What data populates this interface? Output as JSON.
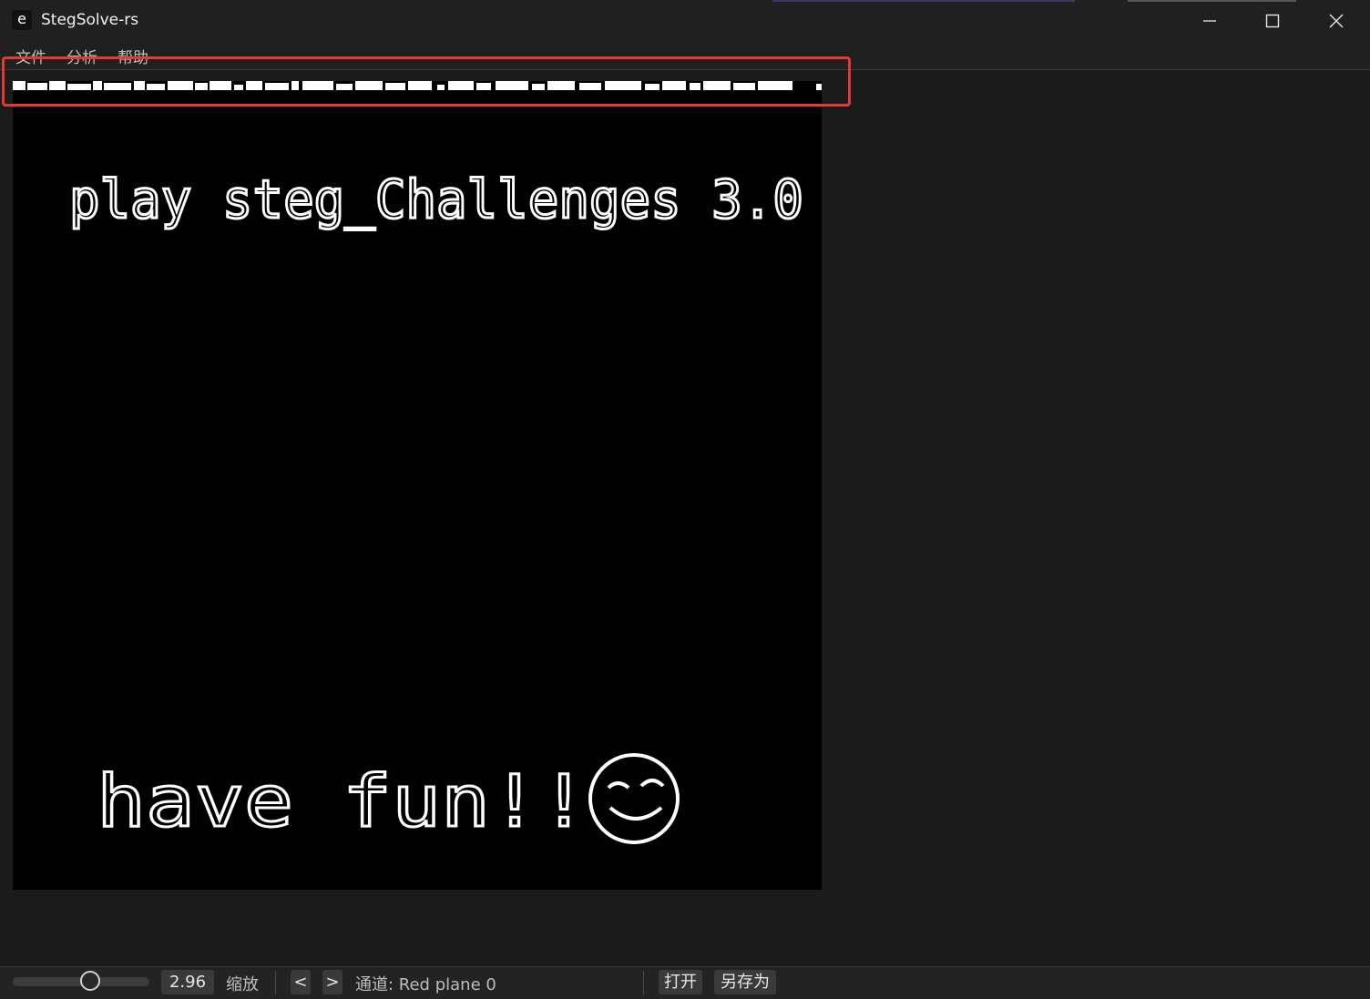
{
  "window": {
    "app_icon_glyph": "e",
    "title": "StegSolve-rs",
    "controls": [
      "minimize-icon",
      "maximize-icon",
      "close-icon"
    ]
  },
  "menu": {
    "items": [
      "文件",
      "分析",
      "帮助"
    ]
  },
  "image": {
    "line1": "play steg_Challenges 3.0",
    "line2": "have fun!!"
  },
  "status": {
    "zoom_value": "2.96",
    "zoom_label": "缩放",
    "prev_label": "<",
    "next_label": ">",
    "channel_text": "通道: Red plane 0",
    "open_label": "打开",
    "save_as_label": "另存为",
    "zoom_slider_fraction": 0.57
  },
  "colors": {
    "highlight": "#e53935",
    "background": "#1b1b1b",
    "bar": "#202020"
  }
}
